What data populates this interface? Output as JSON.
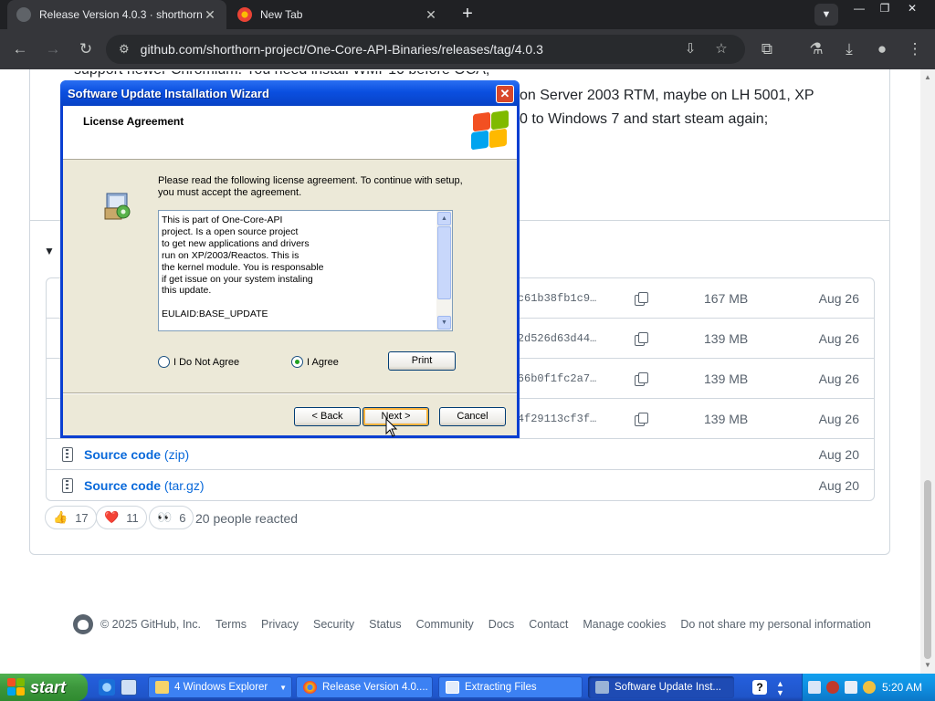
{
  "browser": {
    "tabs": [
      {
        "title": "Release Version 4.0.3 · shorthorn-project/One-Core-API-Binaries",
        "active": true
      },
      {
        "title": "New Tab",
        "active": false
      }
    ],
    "url": "github.com/shorthorn-project/One-Core-API-Binaries/releases/tag/4.0.3"
  },
  "page": {
    "notes": [
      "support newer Chromium. You need install WMP10 before OCA;",
      "on Server 2003 RTM, maybe on LH 5001, XP",
      "0 to Windows 7 and start steam again;"
    ],
    "assets": [
      {
        "hash": "02f1c61b38fb1c9…",
        "size": "167 MB",
        "date": "Aug 26"
      },
      {
        "hash": "33052d526d63d44…",
        "size": "139 MB",
        "date": "Aug 26"
      },
      {
        "hash": "416c66b0f1fc2a7…",
        "size": "139 MB",
        "date": "Aug 26"
      },
      {
        "hash": "437a4f29113cf3f…",
        "size": "139 MB",
        "date": "Aug 26"
      }
    ],
    "source_code": [
      {
        "label": "Source code",
        "format": "(zip)",
        "date": "Aug 20"
      },
      {
        "label": "Source code",
        "format": "(tar.gz)",
        "date": "Aug 20"
      }
    ],
    "reactions": [
      {
        "emoji": "👍",
        "count": "17"
      },
      {
        "emoji": "❤️",
        "count": "11"
      },
      {
        "emoji": "👀",
        "count": "6"
      }
    ],
    "reaction_summary": "20 people reacted",
    "footer": {
      "copyright": "© 2025 GitHub, Inc.",
      "links": [
        "Terms",
        "Privacy",
        "Security",
        "Status",
        "Community",
        "Docs",
        "Contact",
        "Manage cookies",
        "Do not share my personal information"
      ]
    }
  },
  "dialog": {
    "title": "Software Update Installation Wizard",
    "header": "License Agreement",
    "instruction": "Please read the following license agreement. To continue with setup, you must accept the agreement.",
    "license_text": "This is part of One-Core-API\nproject. Is a open source project\nto get new applications and drivers\nrun on XP/2003/Reactos. This is\nthe kernel module. You is responsable\nif get issue on your system instaling\nthis update.\n\nEULAID:BASE_UPDATE",
    "radio_disagree": "I Do Not Agree",
    "radio_agree": "I Agree",
    "print_label": "Print",
    "back_label": "< Back",
    "next_label": "Next >",
    "cancel_label": "Cancel"
  },
  "taskbar": {
    "start_label": "start",
    "items": [
      {
        "label": "4 Windows Explorer"
      },
      {
        "label": "Release Version 4.0...."
      },
      {
        "label": "Extracting Files"
      },
      {
        "label": "Software Update Inst..."
      }
    ],
    "clock": "5:20 AM"
  }
}
